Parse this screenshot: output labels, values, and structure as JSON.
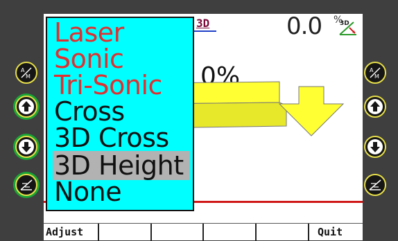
{
  "status": {
    "mode_label": "3D",
    "value": "0.0",
    "unit": "%",
    "grade_icon_label": "3D"
  },
  "display": {
    "percent_text": "0%"
  },
  "menu": {
    "items": [
      {
        "label": "Laser",
        "color": "#e03030",
        "selected": false
      },
      {
        "label": "Sonic",
        "color": "#e03030",
        "selected": false
      },
      {
        "label": "Tri-Sonic",
        "color": "#e03030",
        "selected": false
      },
      {
        "label": "Cross",
        "color": "#111111",
        "selected": false
      },
      {
        "label": "3D Cross",
        "color": "#111111",
        "selected": false
      },
      {
        "label": "3D Height",
        "color": "#111111",
        "selected": true
      },
      {
        "label": "None",
        "color": "#111111",
        "selected": false
      }
    ]
  },
  "softkeys": [
    "Adjust",
    "",
    "",
    "",
    "",
    "Quit"
  ],
  "bezel": {
    "left": [
      "auto-manual-icon",
      "arrow-up-icon",
      "arrow-down-icon",
      "slope-setup-icon"
    ],
    "right": [
      "auto-manual-icon",
      "arrow-up-icon",
      "arrow-down-icon",
      "slope-setup-icon"
    ]
  },
  "colors": {
    "menu_bg": "#00ffff",
    "selected_bg": "#b2b2b2",
    "indicator_yellow": "#ffff33",
    "reference_line": "#d01818",
    "bezel_ring": "#e8e04a",
    "active_ring": "#1aa636"
  }
}
